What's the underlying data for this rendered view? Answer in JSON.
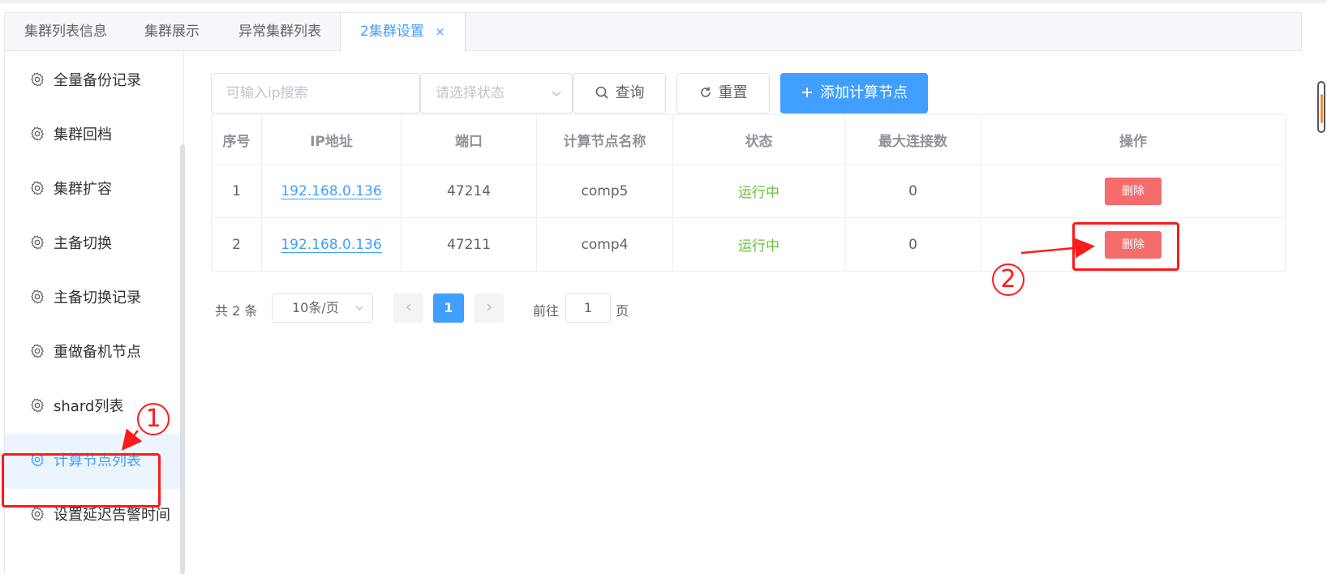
{
  "tabs": [
    {
      "label": "集群列表信息"
    },
    {
      "label": "集群展示"
    },
    {
      "label": "异常集群列表"
    },
    {
      "label": "2集群设置",
      "close": "×"
    }
  ],
  "sidebar": {
    "items": [
      {
        "label": "全量备份记录"
      },
      {
        "label": "集群回档"
      },
      {
        "label": "集群扩容"
      },
      {
        "label": "主备切换"
      },
      {
        "label": "主备切换记录"
      },
      {
        "label": "重做备机节点"
      },
      {
        "label": "shard列表"
      },
      {
        "label": "计算节点列表",
        "active": true
      },
      {
        "label": "设置延迟告警时间"
      }
    ]
  },
  "toolbar": {
    "search_placeholder": "可输入ip搜索",
    "status_placeholder": "请选择状态",
    "query_label": "查询",
    "reset_label": "重置",
    "add_label": "添加计算节点"
  },
  "table": {
    "headers": [
      "序号",
      "IP地址",
      "端口",
      "计算节点名称",
      "状态",
      "最大连接数",
      "操作"
    ],
    "rows": [
      {
        "index": "1",
        "ip": "192.168.0.136",
        "port": "47214",
        "name": "comp5",
        "status": "运行中",
        "max_conn": "0",
        "action": "删除"
      },
      {
        "index": "2",
        "ip": "192.168.0.136",
        "port": "47211",
        "name": "comp4",
        "status": "运行中",
        "max_conn": "0",
        "action": "删除"
      }
    ]
  },
  "pagination": {
    "total": "共 2 条",
    "page_size": "10条/页",
    "current": "1",
    "goto_label": "前往",
    "goto_value": "1",
    "page_suffix": "页"
  },
  "annotations": {
    "one": "1",
    "two": "2"
  },
  "colors": {
    "primary": "#409eff",
    "success": "#67c23a",
    "danger": "#f56c6c",
    "annotation": "#ff1a1a"
  }
}
